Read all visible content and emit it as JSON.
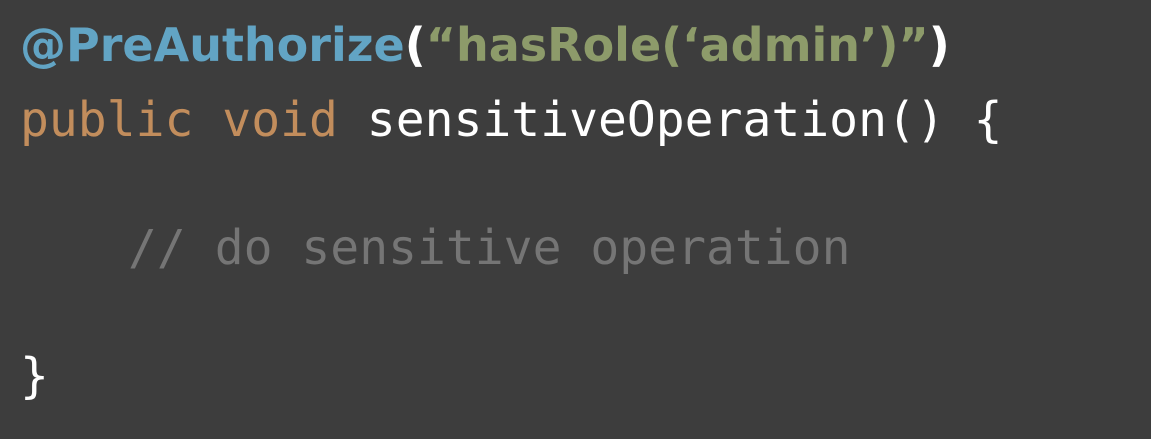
{
  "colors": {
    "background": "#3d3d3d",
    "annotation": "#62a4c4",
    "string": "#8d9b6a",
    "keyword": "#c28d5c",
    "plain": "#ffffff",
    "comment": "#757575"
  },
  "code": {
    "line1": {
      "annotation": "@PreAuthorize",
      "open_paren": "(",
      "argument": "“hasRole(‘admin’)”",
      "close_paren": ")"
    },
    "line2": {
      "modifier": "public",
      "return_type": "void",
      "method_signature": "sensitiveOperation() {"
    },
    "line3": {
      "comment": "// do sensitive operation"
    },
    "line4": {
      "closing_brace": "}"
    }
  }
}
